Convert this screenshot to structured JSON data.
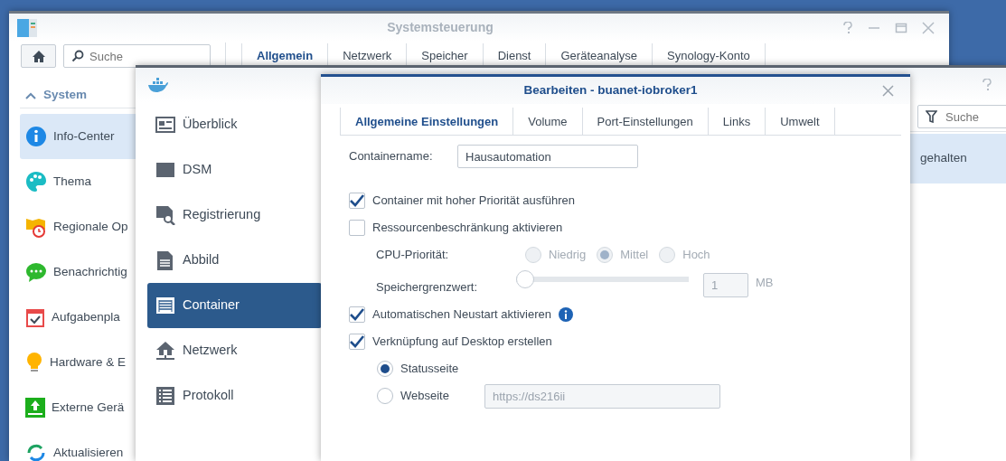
{
  "control_panel": {
    "title": "Systemsteuerung",
    "search": {
      "placeholder": "Suche"
    },
    "tabs": [
      {
        "label": "Allgemein",
        "selected": true
      },
      {
        "label": "Netzwerk",
        "selected": false
      },
      {
        "label": "Speicher",
        "selected": false
      },
      {
        "label": "Dienst",
        "selected": false
      },
      {
        "label": "Geräteanalyse",
        "selected": false
      },
      {
        "label": "Synology-Konto",
        "selected": false
      }
    ],
    "sidebar": {
      "section": "System",
      "expanded": true,
      "items": [
        {
          "label": "Info-Center",
          "selected": true
        },
        {
          "label": "Thema",
          "selected": false
        },
        {
          "label": "Regionale Op",
          "selected": false
        },
        {
          "label": "Benachrichtig",
          "selected": false
        },
        {
          "label": "Aufgabenpla",
          "selected": false
        },
        {
          "label": "Hardware & E",
          "selected": false
        },
        {
          "label": "Externe Gerä",
          "selected": false
        },
        {
          "label": "Aktualisieren",
          "selected": false
        }
      ]
    }
  },
  "docker": {
    "search": {
      "placeholder": "Suche"
    },
    "row_text": "gehalten",
    "sidebar": [
      {
        "label": "Überblick",
        "selected": false
      },
      {
        "label": "DSM",
        "selected": false
      },
      {
        "label": "Registrierung",
        "selected": false
      },
      {
        "label": "Abbild",
        "selected": false
      },
      {
        "label": "Container",
        "selected": true
      },
      {
        "label": "Netzwerk",
        "selected": false
      },
      {
        "label": "Protokoll",
        "selected": false
      }
    ]
  },
  "dialog": {
    "title": "Bearbeiten - buanet-iobroker1",
    "tabs": [
      {
        "label": "Allgemeine Einstellungen",
        "selected": true
      },
      {
        "label": "Volume",
        "selected": false
      },
      {
        "label": "Port-Einstellungen",
        "selected": false
      },
      {
        "label": "Links",
        "selected": false
      },
      {
        "label": "Umwelt",
        "selected": false
      }
    ],
    "container_name": {
      "label": "Containername:",
      "value": "Hausautomation"
    },
    "high_priority": {
      "label": "Container mit hoher Priorität ausführen",
      "checked": true
    },
    "resource_limit": {
      "label": "Ressourcenbeschränkung aktivieren",
      "checked": false
    },
    "cpu_priority": {
      "label": "CPU-Priorität:",
      "disabled": true,
      "options": [
        {
          "label": "Niedrig",
          "selected": false
        },
        {
          "label": "Mittel",
          "selected": true
        },
        {
          "label": "Hoch",
          "selected": false
        }
      ]
    },
    "memory_limit": {
      "label": "Speichergrenzwert:",
      "disabled": true,
      "level": 0,
      "value": "1",
      "unit": "MB"
    },
    "auto_restart": {
      "label": "Automatischen Neustart aktivieren",
      "checked": true
    },
    "desktop_shortcut": {
      "label": "Verknüpfung auf Desktop erstellen",
      "checked": true
    },
    "shortcut_target": {
      "options": [
        {
          "label": "Statusseite",
          "selected": true
        },
        {
          "label": "Webseite",
          "selected": false
        }
      ],
      "url": {
        "value": "https://ds216ii",
        "disabled": true
      }
    }
  }
}
